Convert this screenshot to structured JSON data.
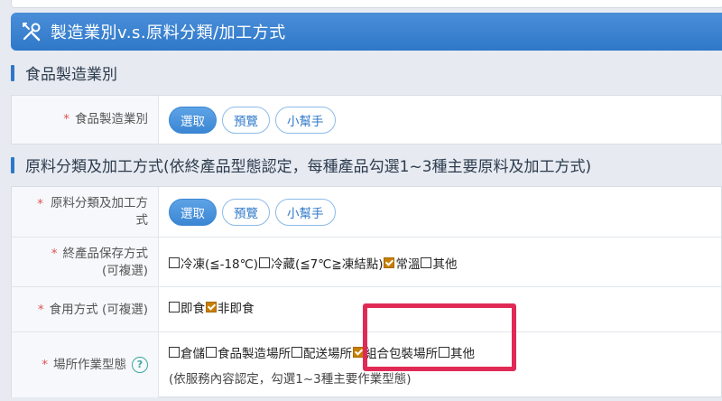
{
  "banner": {
    "title": "製造業別v.s.原料分類/加工方式",
    "icon": "tools-icon"
  },
  "section1": {
    "title": "食品製造業別"
  },
  "food_mfg": {
    "label": "食品製造業別",
    "buttons": {
      "select": "選取",
      "preview": "預覽",
      "helper": "小幫手"
    }
  },
  "section2": {
    "title": "原料分類及加工方式(依終產品型態認定，每種產品勾選1~3種主要原料及加工方式)"
  },
  "raw": {
    "label": "原料分類及加工方式",
    "buttons": {
      "select": "選取",
      "preview": "預覽",
      "helper": "小幫手"
    }
  },
  "storage": {
    "label_line1": "終產品保存方式",
    "label_line2": "(可複選)",
    "options": [
      {
        "text": "冷凍(≦-18℃)",
        "checked": false
      },
      {
        "text": "冷藏(≦7℃≧凍結點)",
        "checked": false
      },
      {
        "text": "常溫",
        "checked": true
      },
      {
        "text": "其他",
        "checked": false
      }
    ]
  },
  "eating": {
    "label": "食用方式 (可複選)",
    "options": [
      {
        "text": "即食",
        "checked": false
      },
      {
        "text": "非即食",
        "checked": true
      }
    ]
  },
  "site": {
    "label": "場所作業型態",
    "help_icon": "question-icon",
    "options": [
      {
        "text": "倉儲",
        "checked": false
      },
      {
        "text": "食品製造場所",
        "checked": false
      },
      {
        "text": "配送場所",
        "checked": false
      },
      {
        "text": "組合包裝場所",
        "checked": true
      },
      {
        "text": "其他",
        "checked": false
      }
    ],
    "note": "(依服務內容認定，勾選1~3種主要作業型態)"
  },
  "required_mark": "*",
  "colors": {
    "accent": "#2f78c9",
    "check": "#c77f00",
    "highlight": "#e02a55"
  }
}
